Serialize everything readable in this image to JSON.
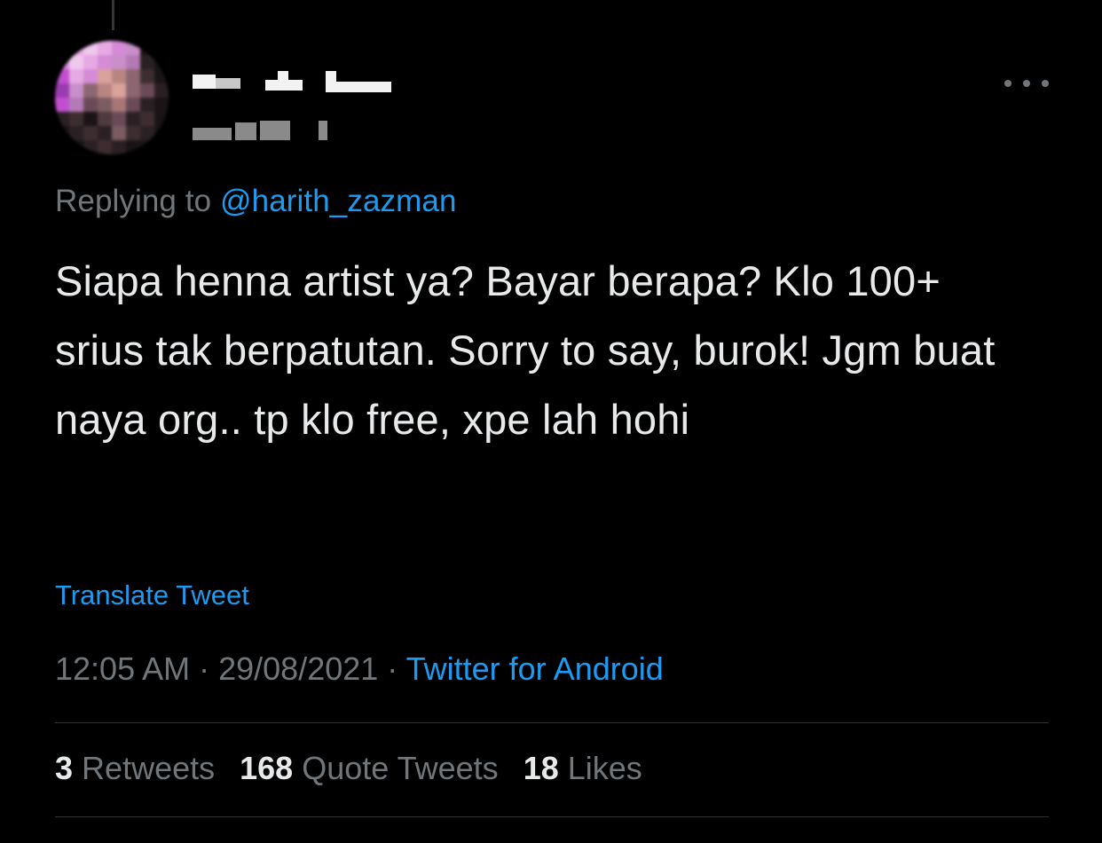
{
  "tweet": {
    "replying_prefix": "Replying to ",
    "replying_handle": "@harith_zazman",
    "text": "Siapa henna artist ya? Bayar berapa? Klo 100+ srius tak berpatutan. Sorry to say, burok! Jgm buat naya org.. tp klo free, xpe lah hohi",
    "translate_label": "Translate Tweet",
    "time": "12:05 AM",
    "date": "29/08/2021",
    "separator": " · ",
    "source": "Twitter for Android"
  },
  "stats": {
    "retweets_count": "3",
    "retweets_label": "Retweets",
    "quotes_count": "168",
    "quotes_label": "Quote Tweets",
    "likes_count": "18",
    "likes_label": "Likes"
  },
  "icons": {
    "more": "more-horizontal-icon"
  },
  "colors": {
    "background": "#000000",
    "text": "#e7e9ea",
    "secondary": "#71767b",
    "accent": "#1d9bf0",
    "divider": "#2f3336"
  }
}
